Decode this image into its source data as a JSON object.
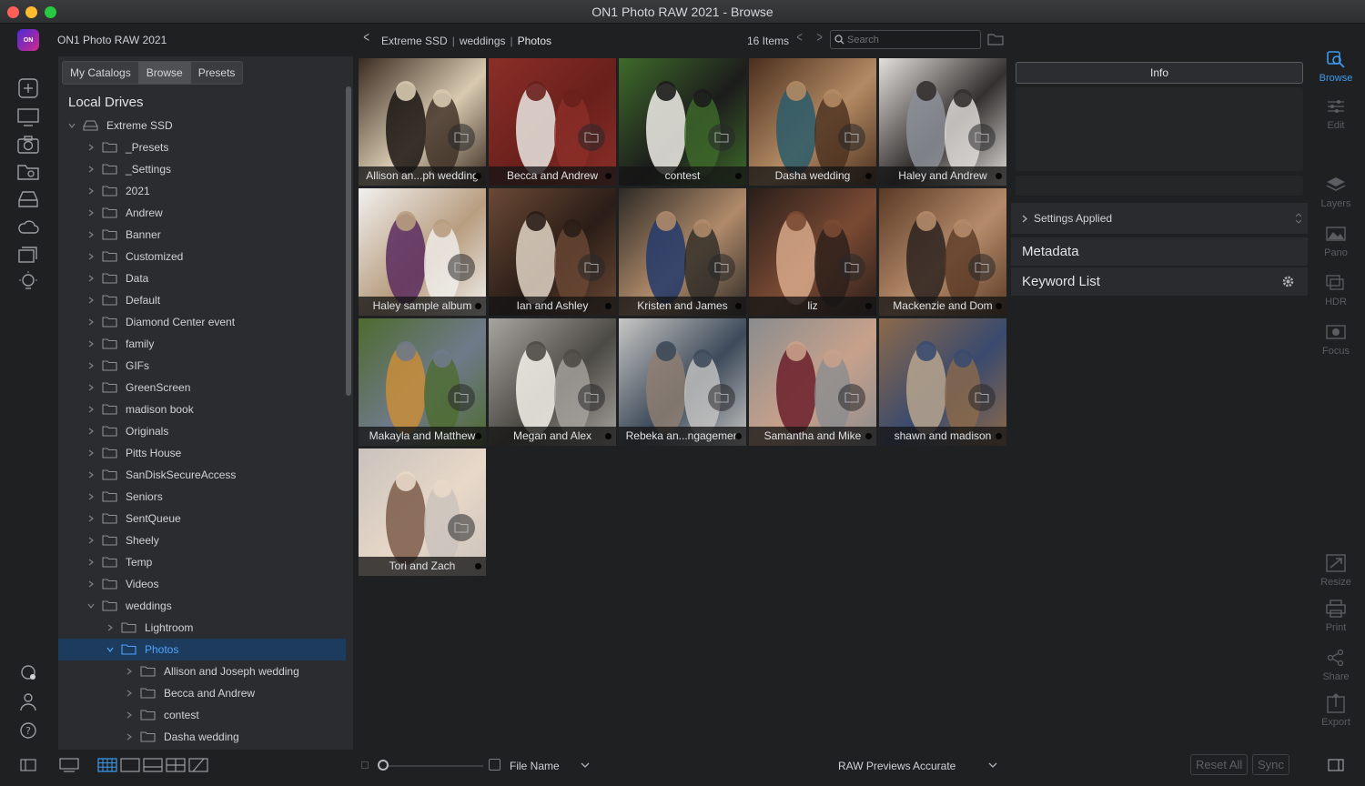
{
  "window": {
    "title": "ON1 Photo RAW 2021 - Browse"
  },
  "app": {
    "name": "ON1 Photo RAW 2021",
    "logo_text": "ON"
  },
  "header": {
    "breadcrumbs": [
      "Extreme SSD",
      "weddings",
      "Photos"
    ],
    "items_count": "16 Items",
    "search_placeholder": "Search"
  },
  "left_toolbar": {
    "icons": [
      "add-icon",
      "monitor-icon",
      "camera-icon",
      "folder-search-icon",
      "drive-icon",
      "cloud-icon",
      "albums-icon",
      "lightbulb-icon",
      "sync-settings-icon",
      "user-icon",
      "help-icon"
    ]
  },
  "side_panel": {
    "tabs": [
      {
        "label": "My Catalogs",
        "active": false
      },
      {
        "label": "Browse",
        "active": true
      },
      {
        "label": "Presets",
        "active": false
      }
    ],
    "section_title": "Local Drives",
    "tree": [
      {
        "label": "Extreme SSD",
        "level": 0,
        "expanded": true,
        "icon": "drive"
      },
      {
        "label": "_Presets",
        "level": 1
      },
      {
        "label": "_Settings",
        "level": 1
      },
      {
        "label": "2021",
        "level": 1
      },
      {
        "label": "Andrew",
        "level": 1
      },
      {
        "label": "Banner",
        "level": 1
      },
      {
        "label": "Customized",
        "level": 1
      },
      {
        "label": "Data",
        "level": 1
      },
      {
        "label": "Default",
        "level": 1
      },
      {
        "label": "Diamond Center event",
        "level": 1
      },
      {
        "label": "family",
        "level": 1
      },
      {
        "label": "GIFs",
        "level": 1
      },
      {
        "label": "GreenScreen",
        "level": 1
      },
      {
        "label": "madison book",
        "level": 1
      },
      {
        "label": "Originals",
        "level": 1
      },
      {
        "label": "Pitts House",
        "level": 1
      },
      {
        "label": "SanDiskSecureAccess",
        "level": 1
      },
      {
        "label": "Seniors",
        "level": 1
      },
      {
        "label": "SentQueue",
        "level": 1
      },
      {
        "label": "Sheely",
        "level": 1
      },
      {
        "label": "Temp",
        "level": 1
      },
      {
        "label": "Videos",
        "level": 1
      },
      {
        "label": "weddings",
        "level": 1,
        "expanded": true
      },
      {
        "label": "Lightroom",
        "level": 2
      },
      {
        "label": "Photos",
        "level": 2,
        "expanded": true,
        "selected": true
      },
      {
        "label": "Allison and Joseph wedding",
        "level": 3
      },
      {
        "label": "Becca and Andrew",
        "level": 3
      },
      {
        "label": "contest",
        "level": 3
      },
      {
        "label": "Dasha wedding",
        "level": 3
      }
    ]
  },
  "grid": {
    "thumbnails": [
      {
        "caption": "Allison an...ph wedding",
        "palette": [
          "#3b2c22",
          "#1b1613",
          "#d8c9b0"
        ]
      },
      {
        "caption": "Becca and Andrew",
        "palette": [
          "#8c2e28",
          "#e9e6e2",
          "#6a201c"
        ]
      },
      {
        "caption": "contest",
        "palette": [
          "#3e6b2a",
          "#f0ede8",
          "#1c1c1c"
        ]
      },
      {
        "caption": "Dasha wedding",
        "palette": [
          "#4a2f1e",
          "#2c5c6b",
          "#b38a63"
        ]
      },
      {
        "caption": "Haley and Andrew",
        "palette": [
          "#e3e0dc",
          "#8b8f96",
          "#34302f"
        ]
      },
      {
        "caption": "Haley sample album",
        "palette": [
          "#f1f0ee",
          "#5a2b5e",
          "#b89d80"
        ]
      },
      {
        "caption": "Ian and Ashley",
        "palette": [
          "#6b4935",
          "#e2d5c5",
          "#2a1d17"
        ]
      },
      {
        "caption": "Kristen and James",
        "palette": [
          "#2d2a26",
          "#233a6b",
          "#b08a6a"
        ]
      },
      {
        "caption": "liz",
        "palette": [
          "#2a1e1a",
          "#d8a98a",
          "#7a4a33"
        ]
      },
      {
        "caption": "Mackenzie and Dom",
        "palette": [
          "#5a3a26",
          "#2d2320",
          "#b58b6a"
        ]
      },
      {
        "caption": "Makayla and Matthew",
        "palette": [
          "#4e6b2f",
          "#c98d3a",
          "#6f7a8a"
        ]
      },
      {
        "caption": "Megan and Alex",
        "palette": [
          "#a7a4a0",
          "#f4f1ea",
          "#4c4a45"
        ]
      },
      {
        "caption": "Rebeka an...ngagemen",
        "palette": [
          "#c7c6c4",
          "#8d7e72",
          "#3d4a5a"
        ]
      },
      {
        "caption": "Samantha and Mike",
        "palette": [
          "#8a8c8e",
          "#6b1f2a",
          "#c8a18b"
        ]
      },
      {
        "caption": "shawn and madison",
        "palette": [
          "#8c6a4a",
          "#b7a58e",
          "#3a4a6e"
        ]
      },
      {
        "caption": "Tori and Zach",
        "palette": [
          "#c9c2bc",
          "#7d5c4a",
          "#e8d8c8"
        ]
      }
    ]
  },
  "right_panel": {
    "info_button": "Info",
    "settings_applied": "Settings Applied",
    "metadata": "Metadata",
    "keyword_list": "Keyword List"
  },
  "right_toolbar": [
    {
      "label": "Browse",
      "icon": "browse-icon",
      "active": true
    },
    {
      "label": "Edit",
      "icon": "edit-icon"
    },
    {
      "label": "Layers",
      "icon": "layers-icon"
    },
    {
      "label": "Pano",
      "icon": "pano-icon"
    },
    {
      "label": "HDR",
      "icon": "hdr-icon"
    },
    {
      "label": "Focus",
      "icon": "focus-icon"
    },
    {
      "label": "Resize",
      "icon": "resize-icon"
    },
    {
      "label": "Print",
      "icon": "print-icon"
    },
    {
      "label": "Share",
      "icon": "share-icon"
    },
    {
      "label": "Export",
      "icon": "export-icon"
    }
  ],
  "bottom_bar": {
    "sort_label": "File Name",
    "raw_previews_label": "RAW Previews",
    "raw_previews_value": "Accurate",
    "reset_all": "Reset All",
    "sync": "Sync"
  }
}
